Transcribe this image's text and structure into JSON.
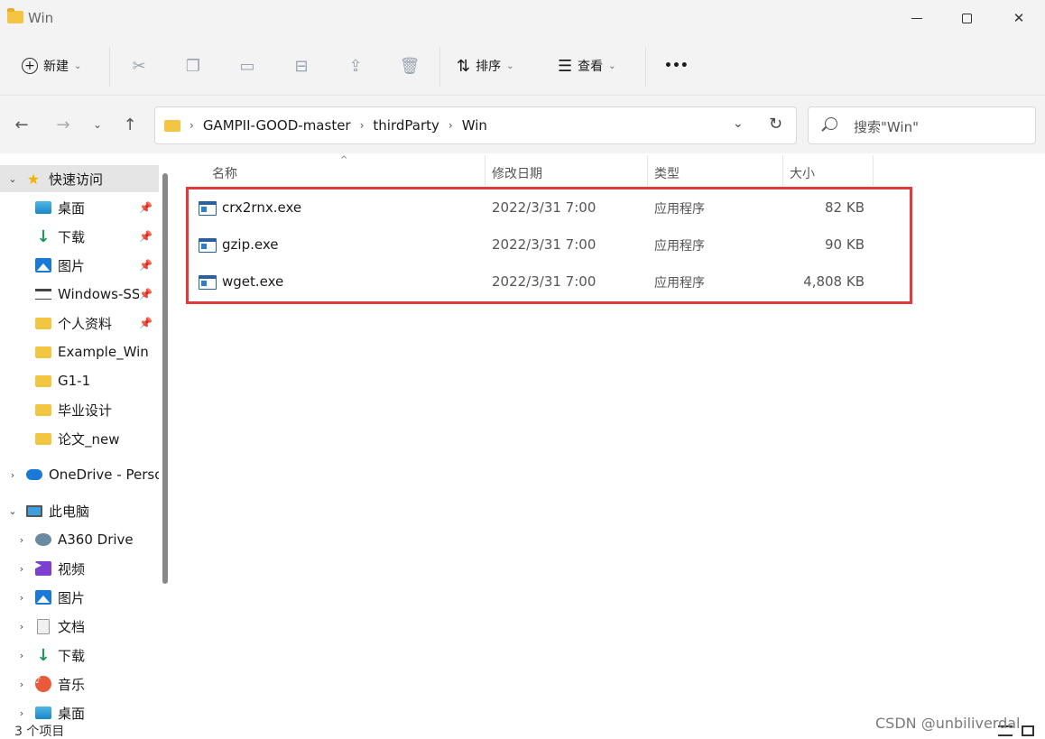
{
  "window": {
    "title": "Win"
  },
  "toolbar": {
    "new_label": "新建",
    "sort_label": "排序",
    "view_label": "查看",
    "more_label": "•••"
  },
  "address": {
    "crumbs": [
      "GAMPII-GOOD-master",
      "thirdParty",
      "Win"
    ]
  },
  "search": {
    "placeholder": "搜索\"Win\""
  },
  "sidebar": {
    "items": [
      {
        "label": "快速访问",
        "icon": "star-icon",
        "expander": "⌄",
        "pinned": false
      },
      {
        "label": "桌面",
        "icon": "desktop-icon",
        "pinned": true
      },
      {
        "label": "下载",
        "icon": "download-icon",
        "pinned": true
      },
      {
        "label": "图片",
        "icon": "pictures-icon",
        "pinned": true
      },
      {
        "label": "Windows-SS",
        "icon": "terminal-icon",
        "pinned": true
      },
      {
        "label": "个人资料",
        "icon": "folder-icon",
        "pinned": true
      },
      {
        "label": "Example_Win",
        "icon": "folder-icon",
        "pinned": false
      },
      {
        "label": "G1-1",
        "icon": "folder-icon",
        "pinned": false
      },
      {
        "label": "毕业设计",
        "icon": "folder-icon",
        "pinned": false
      },
      {
        "label": "论文_new",
        "icon": "folder-icon",
        "pinned": false
      },
      {
        "label": "OneDrive - Perso",
        "icon": "onedrive-icon",
        "expander": "›"
      },
      {
        "label": "此电脑",
        "icon": "this-pc-icon",
        "expander": "⌄"
      },
      {
        "label": "A360 Drive",
        "icon": "drive-icon",
        "expander": "›"
      },
      {
        "label": "视频",
        "icon": "video-icon",
        "expander": "›"
      },
      {
        "label": "图片",
        "icon": "pictures-icon",
        "expander": "›"
      },
      {
        "label": "文档",
        "icon": "documents-icon",
        "expander": "›"
      },
      {
        "label": "下载",
        "icon": "download-icon",
        "expander": "›"
      },
      {
        "label": "音乐",
        "icon": "music-icon",
        "expander": "›"
      },
      {
        "label": "桌面",
        "icon": "desktop-icon",
        "expander": "›"
      }
    ]
  },
  "columns": {
    "name": "名称",
    "modified": "修改日期",
    "type": "类型",
    "size": "大小"
  },
  "files": [
    {
      "name": "crx2rnx.exe",
      "modified": "2022/3/31 7:00",
      "type": "应用程序",
      "size": "82 KB"
    },
    {
      "name": "gzip.exe",
      "modified": "2022/3/31 7:00",
      "type": "应用程序",
      "size": "90 KB"
    },
    {
      "name": "wget.exe",
      "modified": "2022/3/31 7:00",
      "type": "应用程序",
      "size": "4,808 KB"
    }
  ],
  "status": {
    "item_count": "3 个项目"
  },
  "watermark": "CSDN @unbiliverdal",
  "colors": {
    "highlight_border": "#e03a3a",
    "folder": "#f4c542",
    "selected_bg": "#e5e5e5"
  }
}
